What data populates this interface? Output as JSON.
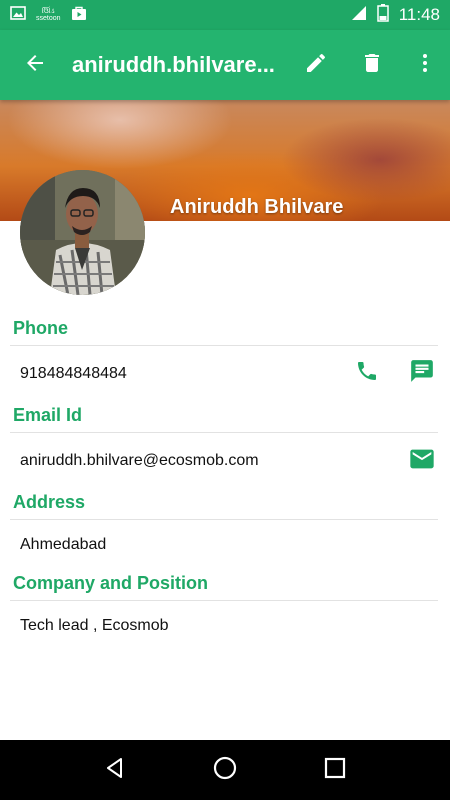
{
  "status_bar": {
    "notif_text_line1": "ઊિંડ",
    "notif_text_line2": "ssetoon",
    "time": "11:48",
    "icons": [
      "image-icon",
      "app-notification-icon",
      "play-store-icon",
      "signal-icon",
      "battery-icon"
    ]
  },
  "app_bar": {
    "title": "aniruddh.bhilvare...",
    "icons": [
      "back-arrow-icon",
      "edit-pencil-icon",
      "delete-trash-icon",
      "more-vert-icon"
    ]
  },
  "profile": {
    "name": "Aniruddh Bhilvare"
  },
  "sections": {
    "phone": {
      "heading": "Phone",
      "value": "918484848484",
      "icons": [
        "phone-icon",
        "message-icon"
      ]
    },
    "email": {
      "heading": "Email Id",
      "value": "aniruddh.bhilvare@ecosmob.com",
      "icons": [
        "email-icon"
      ]
    },
    "address": {
      "heading": "Address",
      "value": "Ahmedabad"
    },
    "company": {
      "heading": "Company and Position",
      "value": "Tech lead , Ecosmob"
    }
  },
  "nav_bar": {
    "icons": [
      "nav-back-icon",
      "nav-home-icon",
      "nav-recents-icon"
    ]
  },
  "colors": {
    "status_bar": "#1fa866",
    "app_bar": "#24b46f",
    "accent": "#1fa866",
    "nav_bar": "#000000"
  }
}
